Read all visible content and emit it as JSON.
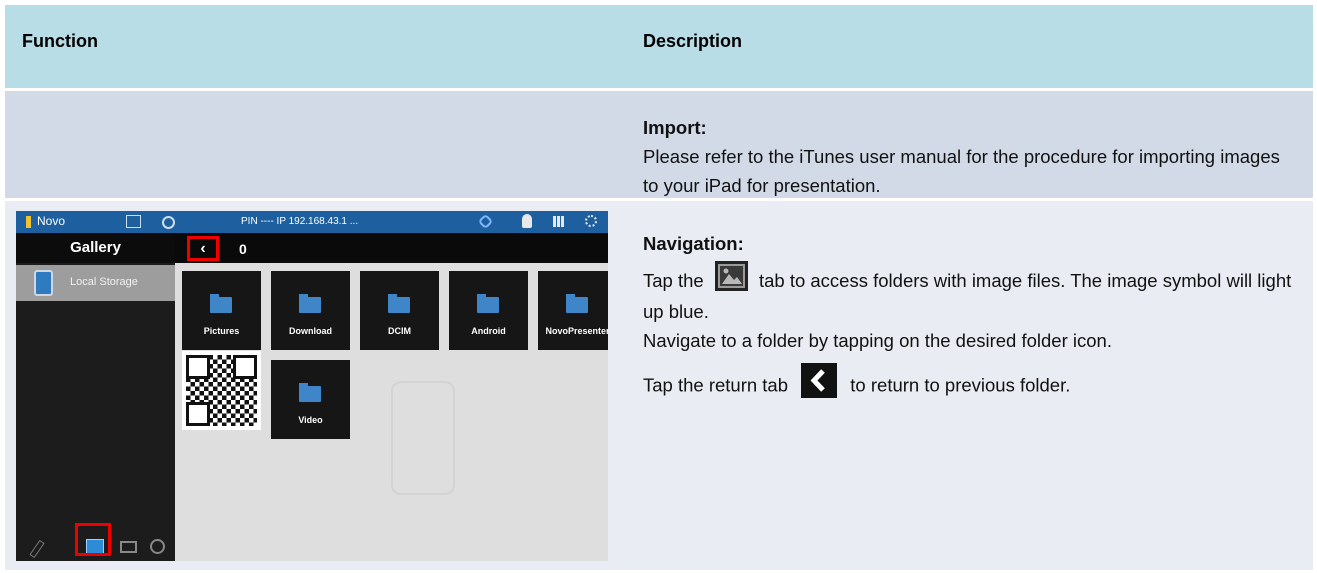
{
  "table": {
    "header": {
      "function": "Function",
      "description": "Description"
    },
    "import": {
      "title": "Import:",
      "text": "Please refer to the iTunes user manual for the procedure for importing images to your iPad for presentation."
    },
    "navigation": {
      "title": "Navigation:",
      "tap_the": "Tap the",
      "tab_text": "tab to access folders with image files. The image symbol will light up blue.",
      "navigate_text": "Navigate to a folder by tapping on the desired folder icon.",
      "return_prefix": "Tap the return tab",
      "return_suffix": "to return to previous folder."
    }
  },
  "app": {
    "app_name": "Novo",
    "status": "PIN ---- IP 192.168.43.1 ...",
    "panel_title": "Gallery",
    "sidebar_item": "Local Storage",
    "folder_count": "0",
    "back_glyph": "‹",
    "folders": [
      "Pictures",
      "Download",
      "DCIM",
      "Android",
      "NovoPresenter",
      "Video"
    ]
  },
  "colors": {
    "header_bg": "#b8dde7",
    "import_row_bg": "#d2dae7",
    "nav_row_bg": "#e9ecf2",
    "status_bar": "#1e5f9f",
    "highlight_red": "#ee0000"
  }
}
